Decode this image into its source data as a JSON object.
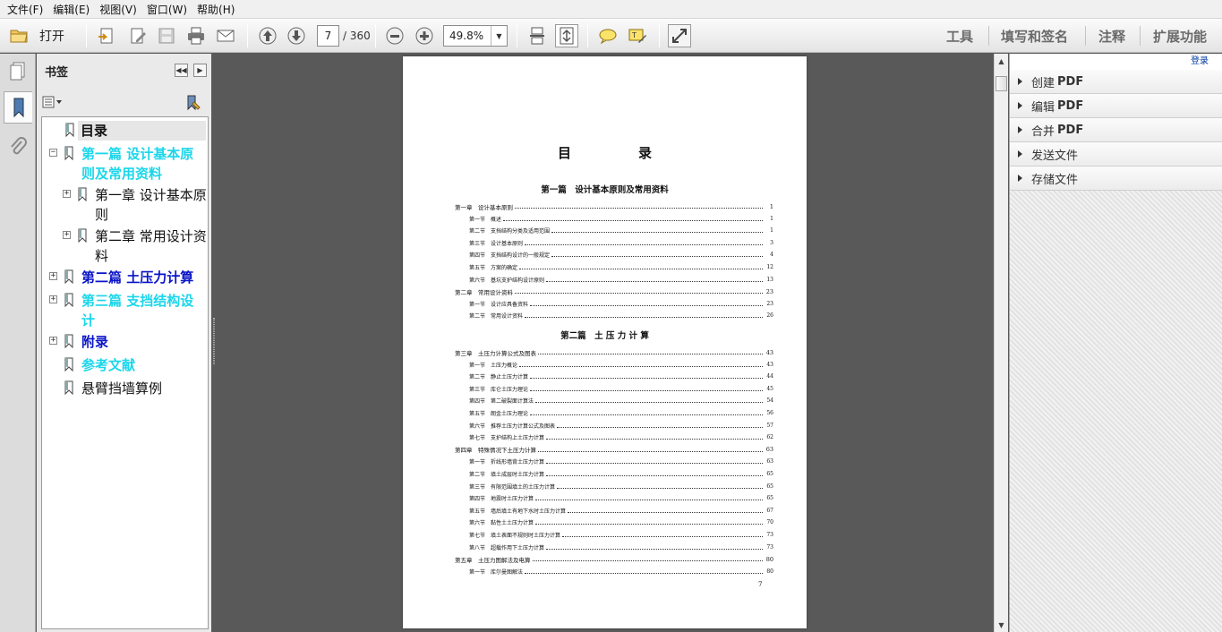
{
  "menu": [
    "文件(F)",
    "编辑(E)",
    "视图(V)",
    "窗口(W)",
    "帮助(H)"
  ],
  "toolbar": {
    "open_label": "打开",
    "page_current": "7",
    "page_total": "/ 360",
    "zoom": "49.8%",
    "right_links": [
      "工具",
      "填写和签名",
      "注释",
      "扩展功能"
    ]
  },
  "bookmarks": {
    "title": "书签",
    "items": [
      {
        "label": "目录",
        "style": "black bold",
        "selected": true
      },
      {
        "label_lines": [
          "第一篇 设计基本原",
          "则及常用资料"
        ],
        "style": "cyan",
        "expander": "−"
      },
      {
        "label_lines": [
          "第一章 设计基本原",
          "则"
        ],
        "style": "black",
        "expander": "+"
      },
      {
        "label_lines": [
          "第二章 常用设计资",
          "料"
        ],
        "style": "black",
        "expander": "+"
      },
      {
        "label": "第二篇 土压力计算",
        "style": "blue",
        "expander": "+"
      },
      {
        "label_lines": [
          "第三篇 支挡结构设",
          "计"
        ],
        "style": "cyan",
        "expander": "+"
      },
      {
        "label": "附录",
        "style": "blue",
        "expander": "+"
      },
      {
        "label": "参考文献",
        "style": "cyan"
      },
      {
        "label": "悬臂挡墙算例",
        "style": "black"
      }
    ]
  },
  "document": {
    "title": "目　录",
    "part1": "第一篇　设计基本原则及常用资料",
    "part2": "第二篇　土 压 力 计 算",
    "page_number": "7",
    "entries_part1": [
      {
        "text": "第一章　设计基本原则",
        "page": "1",
        "level": 1
      },
      {
        "text": "第一节　概述",
        "page": "1",
        "level": 2
      },
      {
        "text": "第二节　支挡结构分类及适用范围",
        "page": "1",
        "level": 2
      },
      {
        "text": "第三节　设计基本原则",
        "page": "3",
        "level": 2
      },
      {
        "text": "第四节　支挡结构设计的一般规定",
        "page": "4",
        "level": 2
      },
      {
        "text": "第五节　方案的确定",
        "page": "12",
        "level": 2
      },
      {
        "text": "第六节　基坑支护结构设计原则",
        "page": "13",
        "level": 2
      },
      {
        "text": "第二章　常用设计资料",
        "page": "23",
        "level": 1
      },
      {
        "text": "第一节　设计应具备资料",
        "page": "23",
        "level": 2
      },
      {
        "text": "第二节　常用设计资料",
        "page": "26",
        "level": 2
      }
    ],
    "entries_part2": [
      {
        "text": "第三章　土压力计算公式及图表",
        "page": "43",
        "level": 1
      },
      {
        "text": "第一节　土压力概论",
        "page": "43",
        "level": 2
      },
      {
        "text": "第二节　静止土压力计算",
        "page": "44",
        "level": 2
      },
      {
        "text": "第三节　库仑土压力理论",
        "page": "45",
        "level": 2
      },
      {
        "text": "第四节　第二破裂面计算法",
        "page": "54",
        "level": 2
      },
      {
        "text": "第五节　朗金土压力理论",
        "page": "56",
        "level": 2
      },
      {
        "text": "第六节　推荐土压力计算公式及图表",
        "page": "57",
        "level": 2
      },
      {
        "text": "第七节　支护结构上土压力计算",
        "page": "62",
        "level": 2
      },
      {
        "text": "第四章　特殊情况下土压力计算",
        "page": "63",
        "level": 1
      },
      {
        "text": "第一节　折线形墙背土压力计算",
        "page": "63",
        "level": 2
      },
      {
        "text": "第二节　填土成层时土压力计算",
        "page": "65",
        "level": 2
      },
      {
        "text": "第三节　有限范围填土的土压力计算",
        "page": "65",
        "level": 2
      },
      {
        "text": "第四节　地震时土压力计算",
        "page": "65",
        "level": 2
      },
      {
        "text": "第五节　墙后填土有地下水时土压力计算",
        "page": "67",
        "level": 2
      },
      {
        "text": "第六节　黏性土土压力计算",
        "page": "70",
        "level": 2
      },
      {
        "text": "第七节　填土表面不规则时土压力计算",
        "page": "73",
        "level": 2
      },
      {
        "text": "第八节　超载作用下土压力计算",
        "page": "73",
        "level": 2
      },
      {
        "text": "第五章　土压力图解法及电算",
        "page": "80",
        "level": 1
      },
      {
        "text": "第一节　库尔曼图解法",
        "page": "80",
        "level": 2
      }
    ]
  },
  "right_panel": {
    "login": "登录",
    "items": [
      {
        "label": "创建",
        "suffix": "PDF"
      },
      {
        "label": "编辑",
        "suffix": "PDF"
      },
      {
        "label": "合并",
        "suffix": "PDF"
      },
      {
        "label": "发送文件",
        "suffix": ""
      },
      {
        "label": "存储文件",
        "suffix": ""
      }
    ]
  }
}
